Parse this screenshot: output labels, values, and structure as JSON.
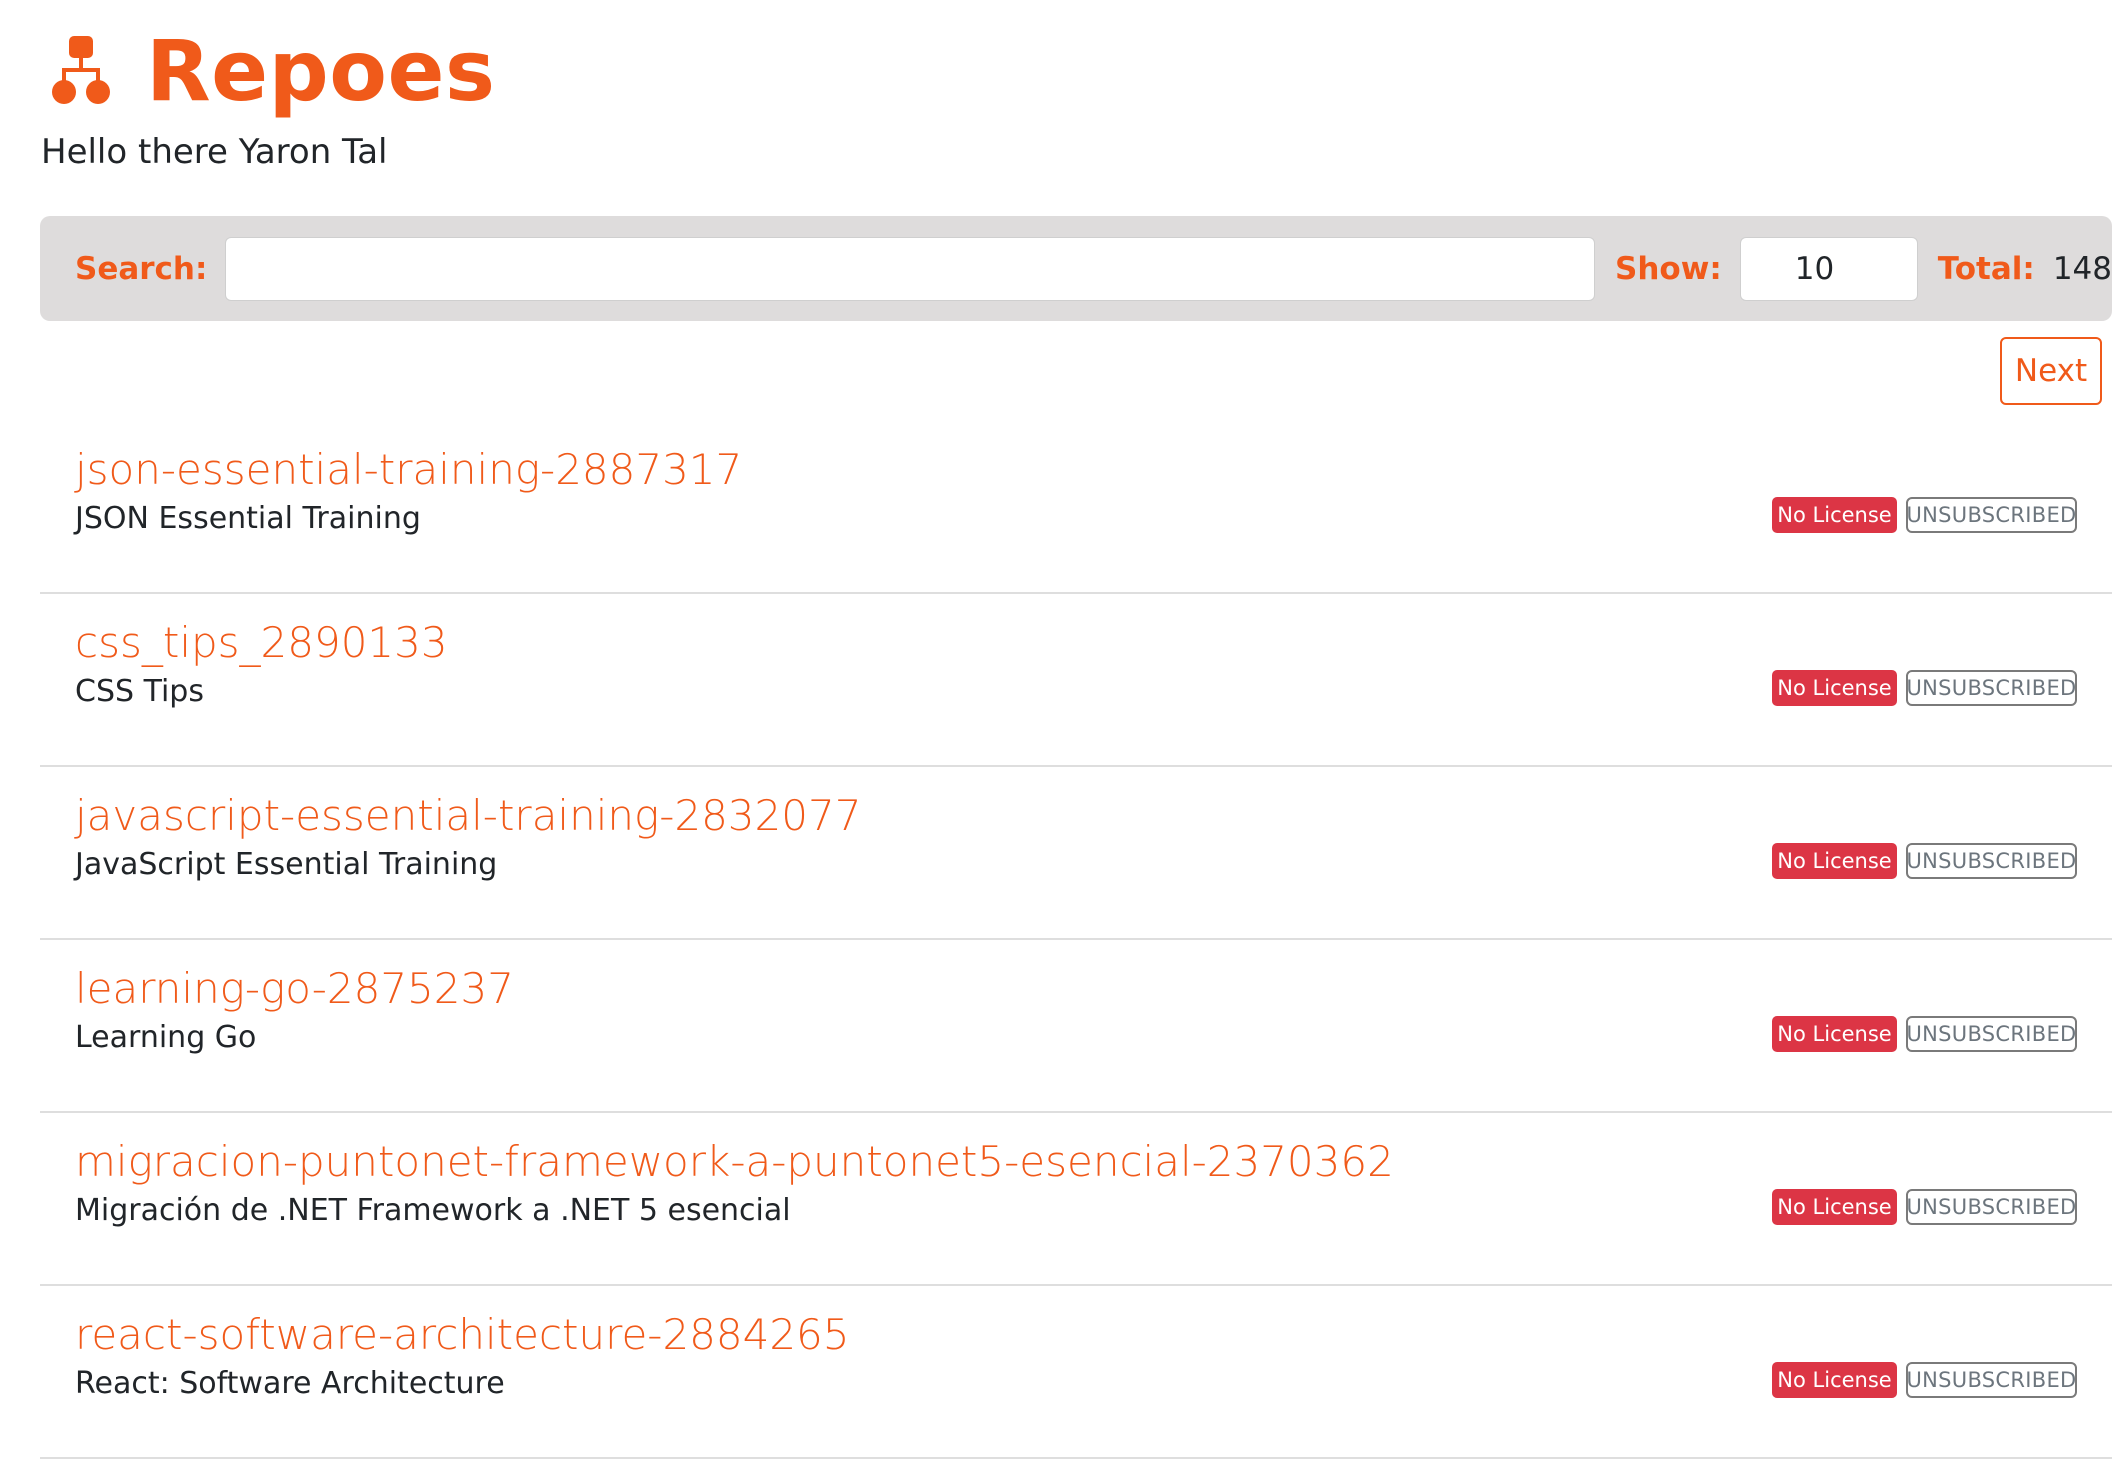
{
  "header": {
    "logo_icon": "sitemap-icon",
    "title": "Repoes",
    "accent_color": "#f05a1a"
  },
  "greeting": "Hello there Yaron Tal",
  "toolbar": {
    "search_label": "Search:",
    "search_value": "",
    "search_placeholder": "",
    "show_label": "Show:",
    "show_value": "10",
    "total_label": "Total:",
    "total_value": "148"
  },
  "pagination": {
    "next_label": "Next"
  },
  "repos": [
    {
      "name": "json-essential-training-2887317",
      "description": "JSON Essential Training",
      "license": "No License",
      "status": "UNSUBSCRIBED"
    },
    {
      "name": "css_tips_2890133",
      "description": "CSS Tips",
      "license": "No License",
      "status": "UNSUBSCRIBED"
    },
    {
      "name": "javascript-essential-training-2832077",
      "description": "JavaScript Essential Training",
      "license": "No License",
      "status": "UNSUBSCRIBED"
    },
    {
      "name": "learning-go-2875237",
      "description": "Learning Go",
      "license": "No License",
      "status": "UNSUBSCRIBED"
    },
    {
      "name": "migracion-puntonet-framework-a-puntonet5-esencial-2370362",
      "description": "Migración de .NET Framework a .NET 5 esencial",
      "license": "No License",
      "status": "UNSUBSCRIBED"
    },
    {
      "name": "react-software-architecture-2884265",
      "description": "React: Software Architecture",
      "license": "No License",
      "status": "UNSUBSCRIBED"
    }
  ],
  "colors": {
    "license_badge": "#dc3545",
    "toolbar_bg": "#dedcdc"
  }
}
